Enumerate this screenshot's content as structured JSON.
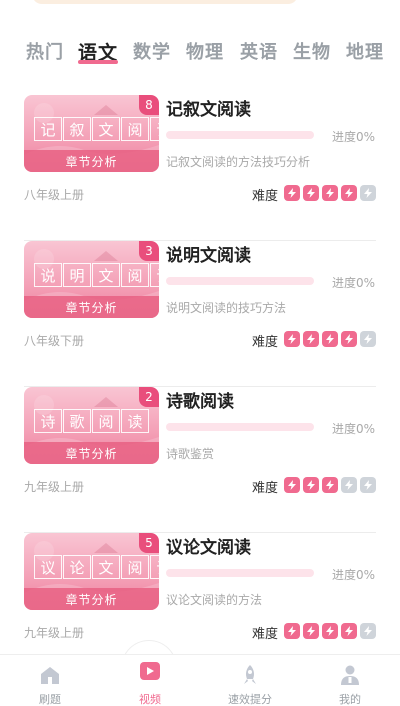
{
  "tabs": [
    "热门",
    "语文",
    "数学",
    "物理",
    "英语",
    "生物",
    "地理"
  ],
  "active_tab_index": 1,
  "colors": {
    "accent": "#f06a8f",
    "inactive": "#cfd4da",
    "tab_inactive": "#9aa0a6"
  },
  "difficulty_label": "难度",
  "cover_subtitle": "章节分析",
  "courses": [
    {
      "count": "8",
      "cover_chars": [
        "记",
        "叙",
        "文",
        "阅",
        "读"
      ],
      "title": "记叙文阅读",
      "progress_text": "进度0%",
      "progress": 0,
      "description": "记叙文阅读的方法技巧分析",
      "grade": "八年级上册",
      "difficulty": 4,
      "difficulty_max": 5
    },
    {
      "count": "3",
      "cover_chars": [
        "说",
        "明",
        "文",
        "阅",
        "读"
      ],
      "title": "说明文阅读",
      "progress_text": "进度0%",
      "progress": 0,
      "description": "说明文阅读的技巧方法",
      "grade": "八年级下册",
      "difficulty": 4,
      "difficulty_max": 5
    },
    {
      "count": "2",
      "cover_chars": [
        "诗",
        "歌",
        "阅",
        "读"
      ],
      "title": "诗歌阅读",
      "progress_text": "进度0%",
      "progress": 0,
      "description": "诗歌鉴赏",
      "grade": "九年级上册",
      "difficulty": 3,
      "difficulty_max": 5
    },
    {
      "count": "5",
      "cover_chars": [
        "议",
        "论",
        "文",
        "阅",
        "读"
      ],
      "title": "议论文阅读",
      "progress_text": "进度0%",
      "progress": 0,
      "description": "议论文阅读的方法",
      "grade": "九年级上册",
      "difficulty": 4,
      "difficulty_max": 5
    }
  ],
  "bottom_nav": [
    {
      "label": "刷题",
      "icon": "home-icon"
    },
    {
      "label": "视频",
      "icon": "video-icon",
      "active": true
    },
    {
      "label": "速效提分",
      "icon": "rocket-icon"
    },
    {
      "label": "我的",
      "icon": "profile-icon"
    }
  ]
}
